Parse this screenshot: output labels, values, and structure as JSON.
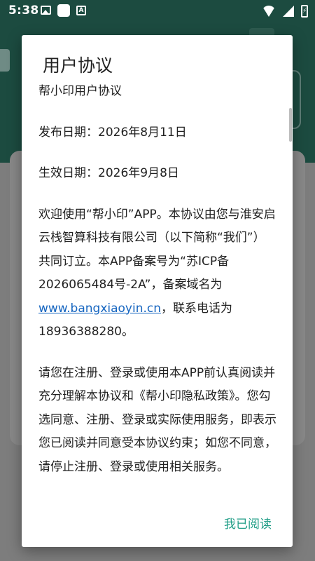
{
  "status_bar": {
    "time": "5:38",
    "notification_icons": [
      "image-icon",
      "square-icon",
      "a-badge-icon"
    ],
    "right_icons": [
      "wifi-icon",
      "signal-icon",
      "battery-icon"
    ]
  },
  "dialog": {
    "title": "用户协议",
    "doc_name": "帮小印用户协议",
    "publish_date": "发布日期：2026年8月11日",
    "effective_date": "生效日期：2026年9月8日",
    "para1_before_link": "欢迎使用“帮小印”APP。本协议由您与淮安启云栈智算科技有限公司（以下简称“我们”）共同订立。本APP备案号为“苏ICP备2026065484号-2A”，备案域名为 ",
    "para1_link": "www.bangxiaoyin.cn",
    "para1_after_link": "，联系电话为18936388280。",
    "para2": "请您在注册、登录或使用本APP前认真阅读并充分理解本协议和《帮小印隐私政策》。您勾选同意、注册、登录或实际使用服务，即表示您已阅读并同意受本协议约束；如您不同意，请停止注册、登录或使用相关服务。",
    "confirm_button": "我已阅读"
  },
  "colors": {
    "accent": "#1f9d86",
    "link": "#1565c0",
    "app_header": "#1c4b40",
    "scrim": "#7f7f7f"
  }
}
